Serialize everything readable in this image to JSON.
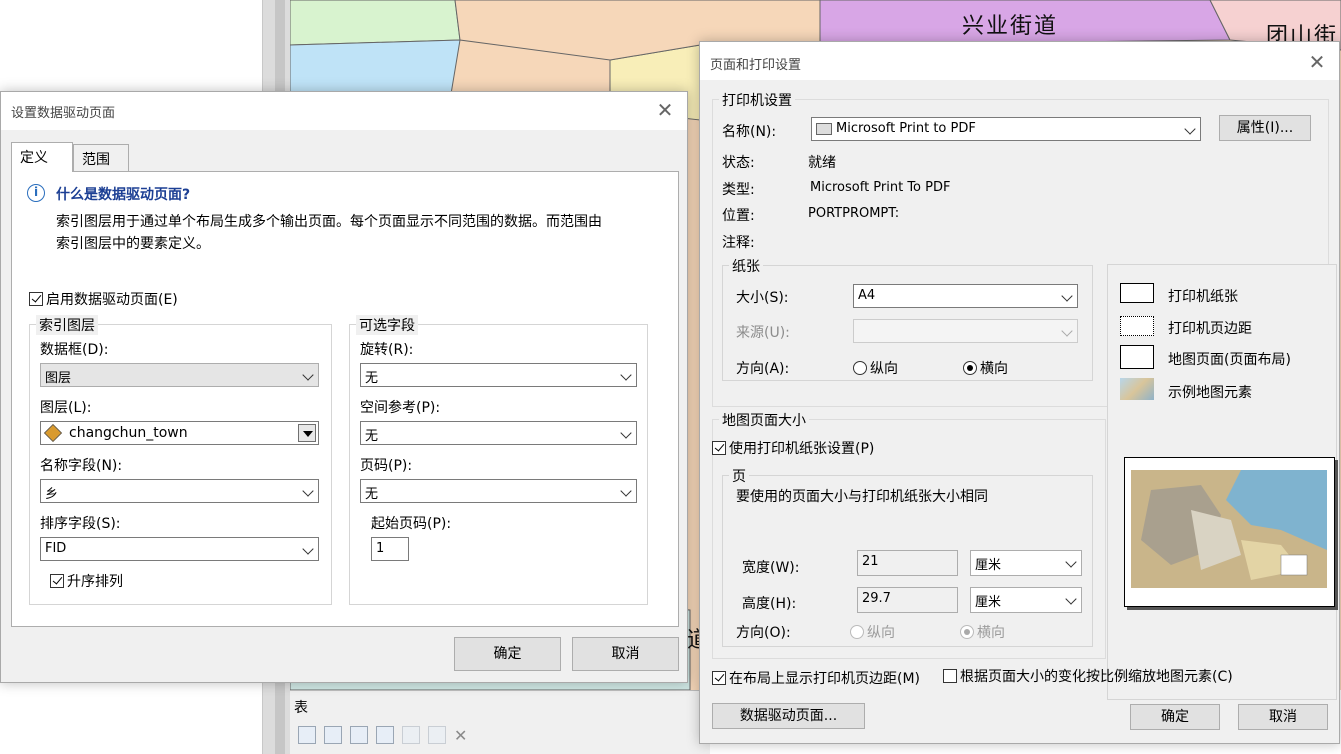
{
  "background": {
    "map_labels": [
      "兴业街道",
      "团山街",
      "道"
    ],
    "table_panel": {
      "title": "表"
    },
    "colors": {
      "map_base": "#f6d7b9",
      "map_green": "#d8f3cf",
      "map_blue": "#bfe3f7",
      "map_purple": "#d8a6e6",
      "map_pink": "#f6d1d1",
      "map_yellow": "#f8eeb8"
    }
  },
  "ddp_dialog": {
    "title": "设置数据驱动页面",
    "tabs": [
      "定义",
      "范围"
    ],
    "info": {
      "heading": "什么是数据驱动页面?",
      "line1": "索引图层用于通过单个布局生成多个输出页面。每个页面显示不同范围的数据。而范围由",
      "line2": "索引图层中的要素定义。"
    },
    "enable_label": "启用数据驱动页面(E)",
    "index_group": {
      "title": "索引图层",
      "frame_label": "数据框(D):",
      "frame_value": "图层",
      "layer_label": "图层(L):",
      "layer_value": "changchun_town",
      "name_field_label": "名称字段(N):",
      "name_field_value": "乡",
      "sort_field_label": "排序字段(S):",
      "sort_field_value": "FID",
      "ascending_label": "升序排列"
    },
    "optional_group": {
      "title": "可选字段",
      "rotation_label": "旋转(R):",
      "rotation_value": "无",
      "spatial_ref_label": "空间参考(P):",
      "spatial_ref_value": "无",
      "page_num_label": "页码(P):",
      "page_num_value": "无",
      "start_page_label": "起始页码(P):",
      "start_page_value": "1"
    },
    "ok": "确定",
    "cancel": "取消"
  },
  "print_dialog": {
    "title": "页面和打印设置",
    "printer_group": {
      "title": "打印机设置",
      "name_label": "名称(N):",
      "name_value": "Microsoft Print to PDF",
      "properties_button": "属性(I)...",
      "status_label": "状态:",
      "status_value": "就绪",
      "type_label": "类型:",
      "type_value": "Microsoft Print To PDF",
      "location_label": "位置:",
      "location_value": "PORTPROMPT:",
      "comment_label": "注释:"
    },
    "paper_group": {
      "title": "纸张",
      "size_label": "大小(S):",
      "size_value": "A4",
      "source_label": "来源(U):",
      "source_value": "",
      "orientation_label": "方向(A):",
      "portrait": "纵向",
      "landscape": "横向"
    },
    "legend": {
      "printer_paper": "打印机纸张",
      "printer_margins": "打印机页边距",
      "map_page": "地图页面(页面布局)",
      "sample_elements": "示例地图元素"
    },
    "map_page_group": {
      "title": "地图页面大小",
      "use_printer_label": "使用打印机纸张设置(P)",
      "page_title": "页",
      "page_note": "要使用的页面大小与打印机纸张大小相同",
      "width_label": "宽度(W):",
      "width_value": "21",
      "width_unit": "厘米",
      "height_label": "高度(H):",
      "height_value": "29.7",
      "height_unit": "厘米",
      "orientation_label": "方向(O):",
      "portrait": "纵向",
      "landscape": "横向"
    },
    "show_margins_label": "在布局上显示打印机页边距(M)",
    "scale_elements_label": "根据页面大小的变化按比例缩放地图元素(C)",
    "ddp_button": "数据驱动页面...",
    "ok": "确定",
    "cancel": "取消"
  }
}
